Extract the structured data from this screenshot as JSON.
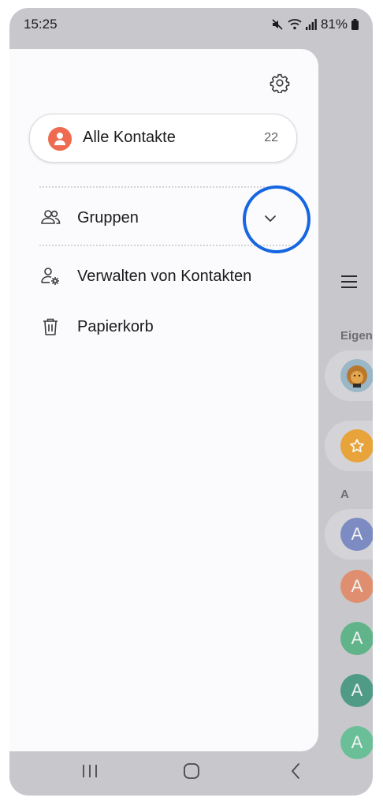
{
  "status": {
    "time": "15:25",
    "battery": "81%",
    "icons": [
      "mute-icon",
      "wifi-icon",
      "signal-icon",
      "battery-icon"
    ]
  },
  "drawer": {
    "settings_icon": "gear-icon",
    "all_contacts": {
      "label": "Alle Kontakte",
      "count": "22"
    },
    "menu": [
      {
        "label": "Gruppen",
        "icon": "groups-icon"
      },
      {
        "label": "Verwalten von Kontakten",
        "icon": "manage-contacts-icon"
      },
      {
        "label": "Papierkorb",
        "icon": "trash-icon"
      }
    ]
  },
  "background": {
    "section_own": "Eigen",
    "section_a": "A",
    "avatar_letter": "A"
  },
  "colors": {
    "accent_ring": "#1566e0",
    "all_contacts_avatar": "#ee6a50",
    "favorite": "#e8a33a"
  }
}
